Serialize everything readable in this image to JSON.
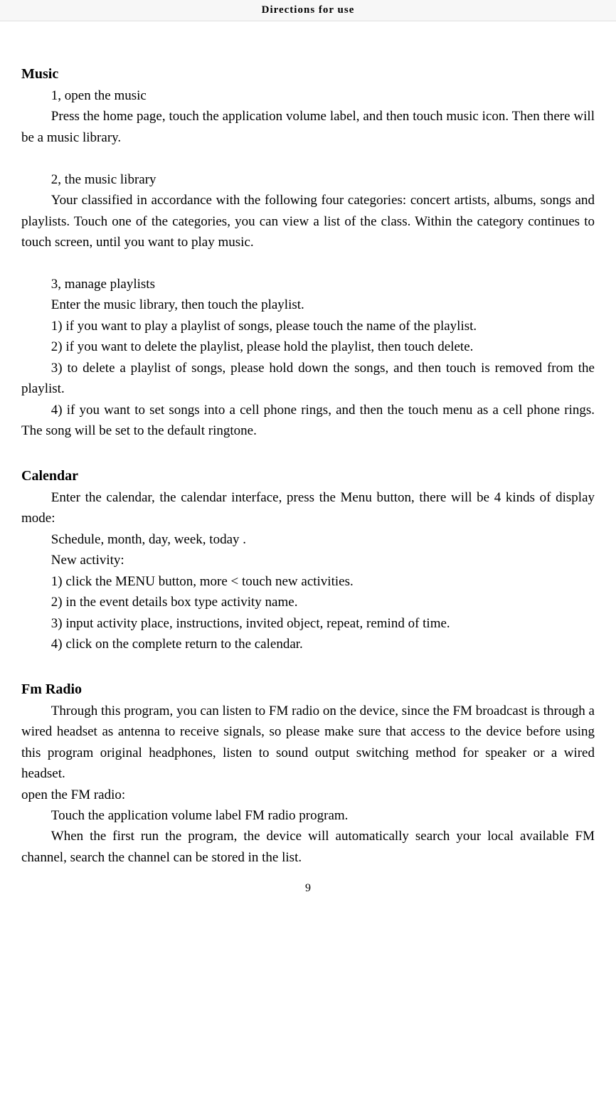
{
  "header": {
    "title": "Directions for use"
  },
  "sections": {
    "music": {
      "heading": "Music",
      "p1": "1, open the music",
      "p2": "Press the home page, touch the application volume label, and then touch music icon. Then there will be a music library.",
      "p3": "2, the music library",
      "p4": "Your classified in accordance with the following four categories: concert artists, albums, songs and playlists. Touch one of the categories, you can view a list of the class. Within the category continues to touch screen, until you want to play music.",
      "p5": "3, manage playlists",
      "p6": "Enter the music library, then touch the playlist.",
      "p7": "1) if you want to play a playlist of songs, please touch the name of the playlist.",
      "p8": "2) if you want to delete the playlist, please hold the playlist, then touch delete.",
      "p9": "3) to delete a playlist of songs, please hold down the songs, and then touch is removed from the playlist.",
      "p10": "4) if you want to set songs into a cell phone rings, and then the touch menu as a cell phone rings. The song will be set to the default ringtone."
    },
    "calendar": {
      "heading": "Calendar",
      "p1": "Enter the calendar, the calendar interface, press the Menu button, there will be 4 kinds of display mode:",
      "p2": "Schedule, month, day, week, today .",
      "p3": " New activity:",
      "p4": "1) click the MENU button, more < touch new activities.",
      "p5": "2) in the event details box type activity name.",
      "p6": "3) input activity place, instructions, invited object, repeat, remind of time.",
      "p7": "4) click on the complete return to the calendar."
    },
    "fmradio": {
      "heading": "Fm Radio",
      "p1": "Through this program, you can listen to FM radio on the device, since the FM broadcast is through a wired headset as antenna to receive signals, so please make sure that access to the device before using this program original headphones, listen to sound output switching method for speaker or a wired headset.",
      "p2": " open the FM radio:",
      "p3": "Touch the application volume label FM radio program.",
      "p4": "When the first run the program, the device will automatically search your local available FM channel, search the channel can be stored in the list."
    }
  },
  "pageNumber": "9"
}
